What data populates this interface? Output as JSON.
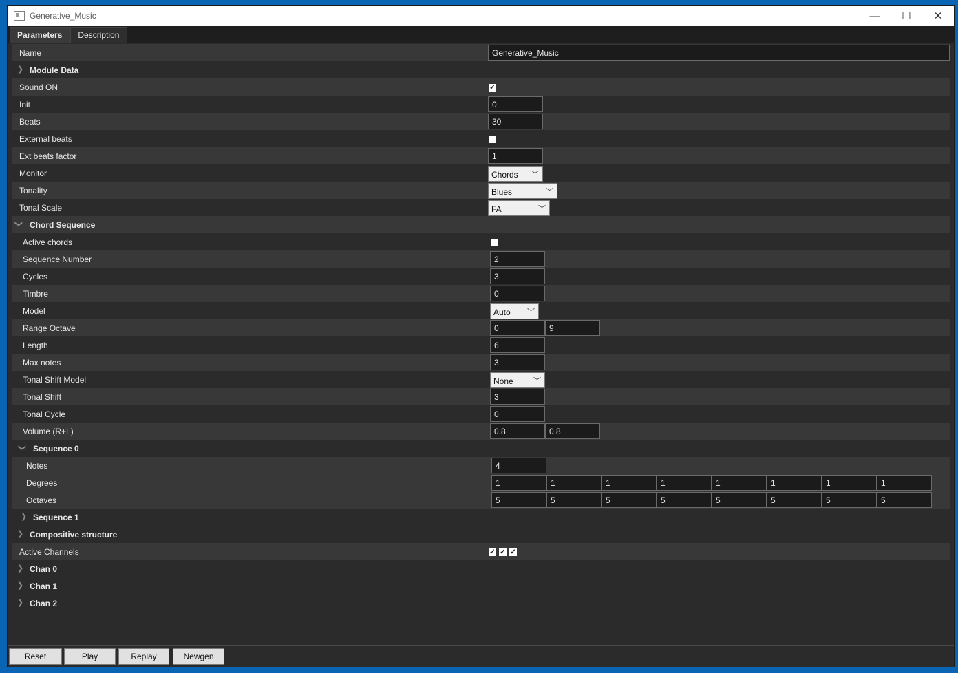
{
  "window": {
    "title": "Generative_Music",
    "minimize": "—",
    "maximize": "☐",
    "close": "✕"
  },
  "tabs": [
    {
      "label": "Parameters"
    },
    {
      "label": "Description"
    }
  ],
  "params": {
    "name_label": "Name",
    "name_value": "Generative_Music",
    "module_data": "Module Data",
    "sound_on": "Sound ON",
    "init_label": "Init",
    "init_value": "0",
    "beats_label": "Beats",
    "beats_value": "30",
    "external_beats": "External beats",
    "ext_factor_label": "Ext beats factor",
    "ext_factor_value": "1",
    "monitor_label": "Monitor",
    "monitor_value": "Chords",
    "tonality_label": "Tonality",
    "tonality_value": "Blues",
    "tonal_scale_label": "Tonal Scale",
    "tonal_scale_value": "FA"
  },
  "chord_sequence": {
    "header": "Chord Sequence",
    "active_chords": "Active chords",
    "seq_number_label": "Sequence Number",
    "seq_number_value": "2",
    "cycles_label": "Cycles",
    "cycles_value": "3",
    "timbre_label": "Timbre",
    "timbre_value": "0",
    "model_label": "Model",
    "model_value": "Auto",
    "range_octave_label": "Range Octave",
    "range_octave_min": "0",
    "range_octave_max": "9",
    "length_label": "Length",
    "length_value": "6",
    "max_notes_label": "Max notes",
    "max_notes_value": "3",
    "tonal_shift_model_label": "Tonal Shift Model",
    "tonal_shift_model_value": "None",
    "tonal_shift_label": "Tonal Shift",
    "tonal_shift_value": "3",
    "tonal_cycle_label": "Tonal Cycle",
    "tonal_cycle_value": "0",
    "volume_label": "Volume (R+L)",
    "volume_r": "0.8",
    "volume_l": "0.8"
  },
  "sequence0": {
    "header": "Sequence 0",
    "notes_label": "Notes",
    "notes_value": "4",
    "degrees_label": "Degrees",
    "degrees": [
      "1",
      "1",
      "1",
      "1",
      "1",
      "1",
      "1",
      "1"
    ],
    "octaves_label": "Octaves",
    "octaves": [
      "5",
      "5",
      "5",
      "5",
      "5",
      "5",
      "5",
      "5"
    ]
  },
  "sequence1": {
    "header": "Sequence 1"
  },
  "compositive": {
    "header": "Compositive structure"
  },
  "active_channels": {
    "label": "Active Channels"
  },
  "channels": [
    "Chan 0",
    "Chan 1",
    "Chan 2"
  ],
  "buttons": {
    "reset": "Reset",
    "play": "Play",
    "replay": "Replay",
    "newgen": "Newgen"
  }
}
